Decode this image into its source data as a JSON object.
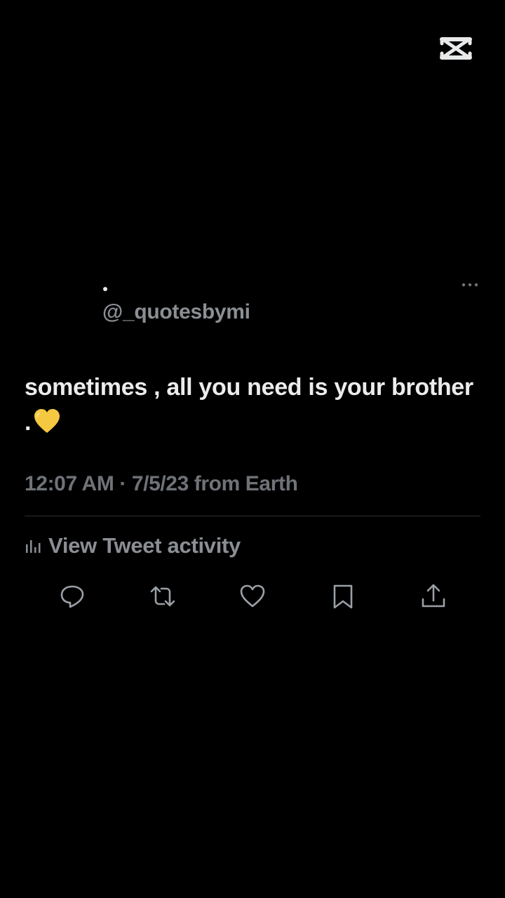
{
  "tweet": {
    "handle": "@_quotesbymi",
    "text": "sometimes , all you need is your brother .",
    "emoji": "yellow-heart-emoji",
    "meta": "12:07 AM · 7/5/23 from Earth"
  },
  "activity": {
    "label": "View Tweet activity",
    "icon": "bar-chart-icon"
  },
  "actions": [
    {
      "name": "reply",
      "icon": "reply-icon"
    },
    {
      "name": "retweet",
      "icon": "retweet-icon"
    },
    {
      "name": "like",
      "icon": "heart-icon"
    },
    {
      "name": "bookmark",
      "icon": "bookmark-icon"
    },
    {
      "name": "share",
      "icon": "share-icon"
    }
  ],
  "colors": {
    "background": "#000000",
    "text": "#ececec",
    "secondary": "#8b8f94",
    "muted": "#6f7378",
    "heart": "#f5c842"
  }
}
